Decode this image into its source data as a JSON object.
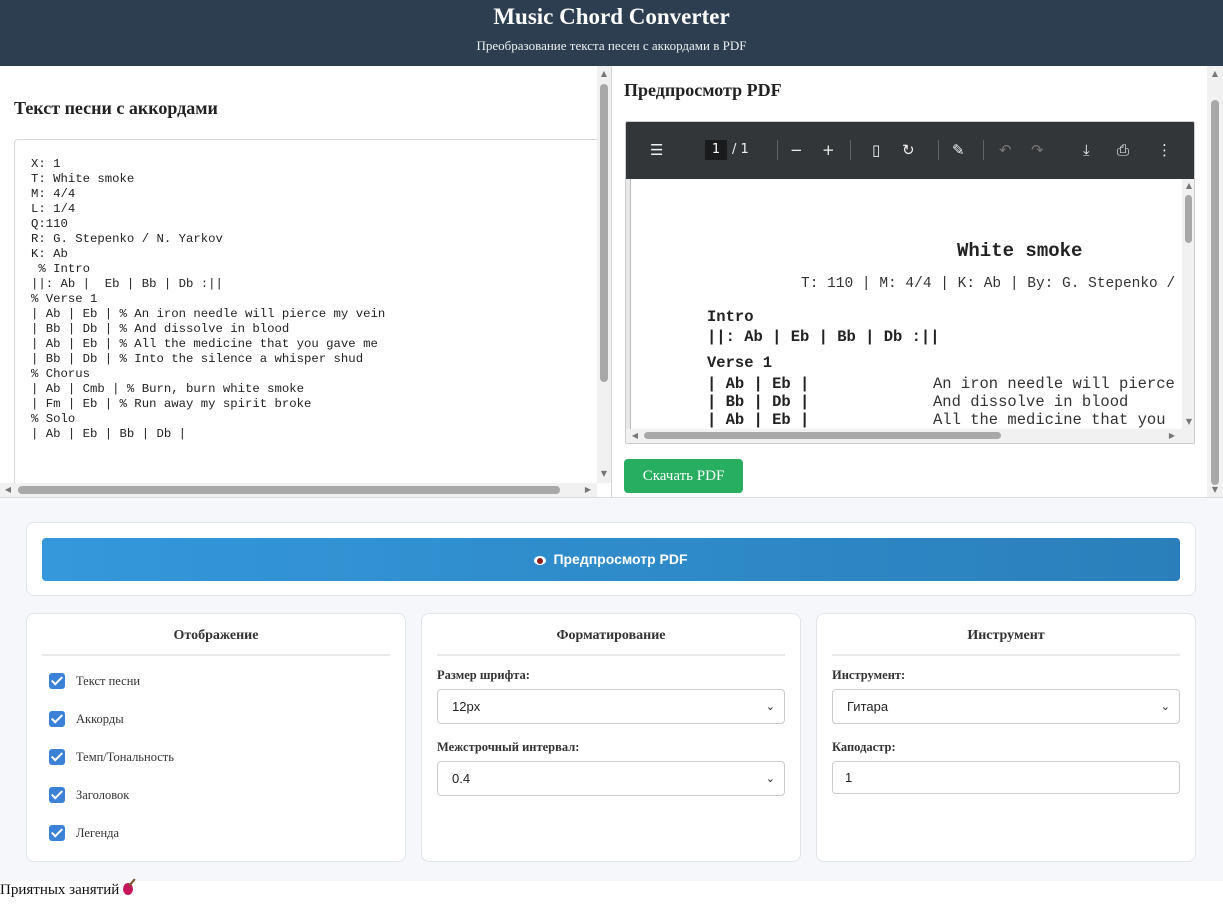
{
  "header": {
    "title": "Music Chord Converter",
    "subtitle": "Преобразование текста песен с аккордами в PDF"
  },
  "editor": {
    "heading": "Текст песни с аккордами",
    "content": "X: 1\nT: White smoke\nM: 4/4\nL: 1/4\nQ:110\nR: G. Stepenko / N. Yarkov\nK: Ab\n % Intro\n||: Ab |  Eb | Bb | Db :||\n% Verse 1\n| Ab | Eb | % An iron needle will pierce my vein\n| Bb | Db | % And dissolve in blood\n| Ab | Eb | % All the medicine that you gave me\n| Bb | Db | % Into the silence a whisper shud\n% Chorus\n| Ab | Cmb | % Burn, burn white smoke\n| Fm | Eb | % Run away my spirit broke\n% Solo\n| Ab | Eb | Bb | Db |"
  },
  "preview": {
    "heading": "Предпросмотр PDF",
    "toolbar": {
      "page_current": "1",
      "page_total": "/ 1",
      "icons": [
        "menu-icon",
        "zoom-out-icon",
        "zoom-in-icon",
        "fit-page-icon",
        "rotate-icon",
        "annotate-icon",
        "undo-icon",
        "redo-icon",
        "download-icon",
        "print-icon",
        "more-icon"
      ]
    },
    "pdf": {
      "title": "White smoke",
      "meta": "T: 110 | M: 4/4 | K: Ab | By: G. Stepenko /",
      "intro_heading": "Intro",
      "intro_line": "||: Ab |  Eb | Bb | Db :||",
      "verse_heading": "Verse 1",
      "lines": [
        {
          "chords": "| Ab | Eb |",
          "lyric": "An iron needle will pierce"
        },
        {
          "chords": "| Bb | Db |",
          "lyric": "And dissolve in blood"
        },
        {
          "chords": "| Ab | Eb |",
          "lyric": "All the medicine that you"
        }
      ]
    },
    "download_label": "Скачать PDF"
  },
  "actions": {
    "preview_label": "Предпросмотр PDF"
  },
  "display": {
    "title": "Отображение",
    "options": [
      {
        "label": "Текст песни",
        "checked": true
      },
      {
        "label": "Аккорды",
        "checked": true
      },
      {
        "label": "Темп/Тональность",
        "checked": true
      },
      {
        "label": "Заголовок",
        "checked": true
      },
      {
        "label": "Легенда",
        "checked": true
      }
    ]
  },
  "formatting": {
    "title": "Форматирование",
    "font_size_label": "Размер шрифта:",
    "font_size_value": "12px",
    "line_spacing_label": "Межстрочный интервал:",
    "line_spacing_value": "0.4"
  },
  "instrument": {
    "title": "Инструмент",
    "instrument_label": "Инструмент:",
    "instrument_value": "Гитара",
    "capo_label": "Каподастр:",
    "capo_value": "1"
  },
  "footer": {
    "text": "Приятных занятий"
  },
  "colors": {
    "header_bg": "#2c3e50",
    "download_button": "#27ae60",
    "preview_button": "#3498db",
    "checkbox": "#3b82d6"
  }
}
